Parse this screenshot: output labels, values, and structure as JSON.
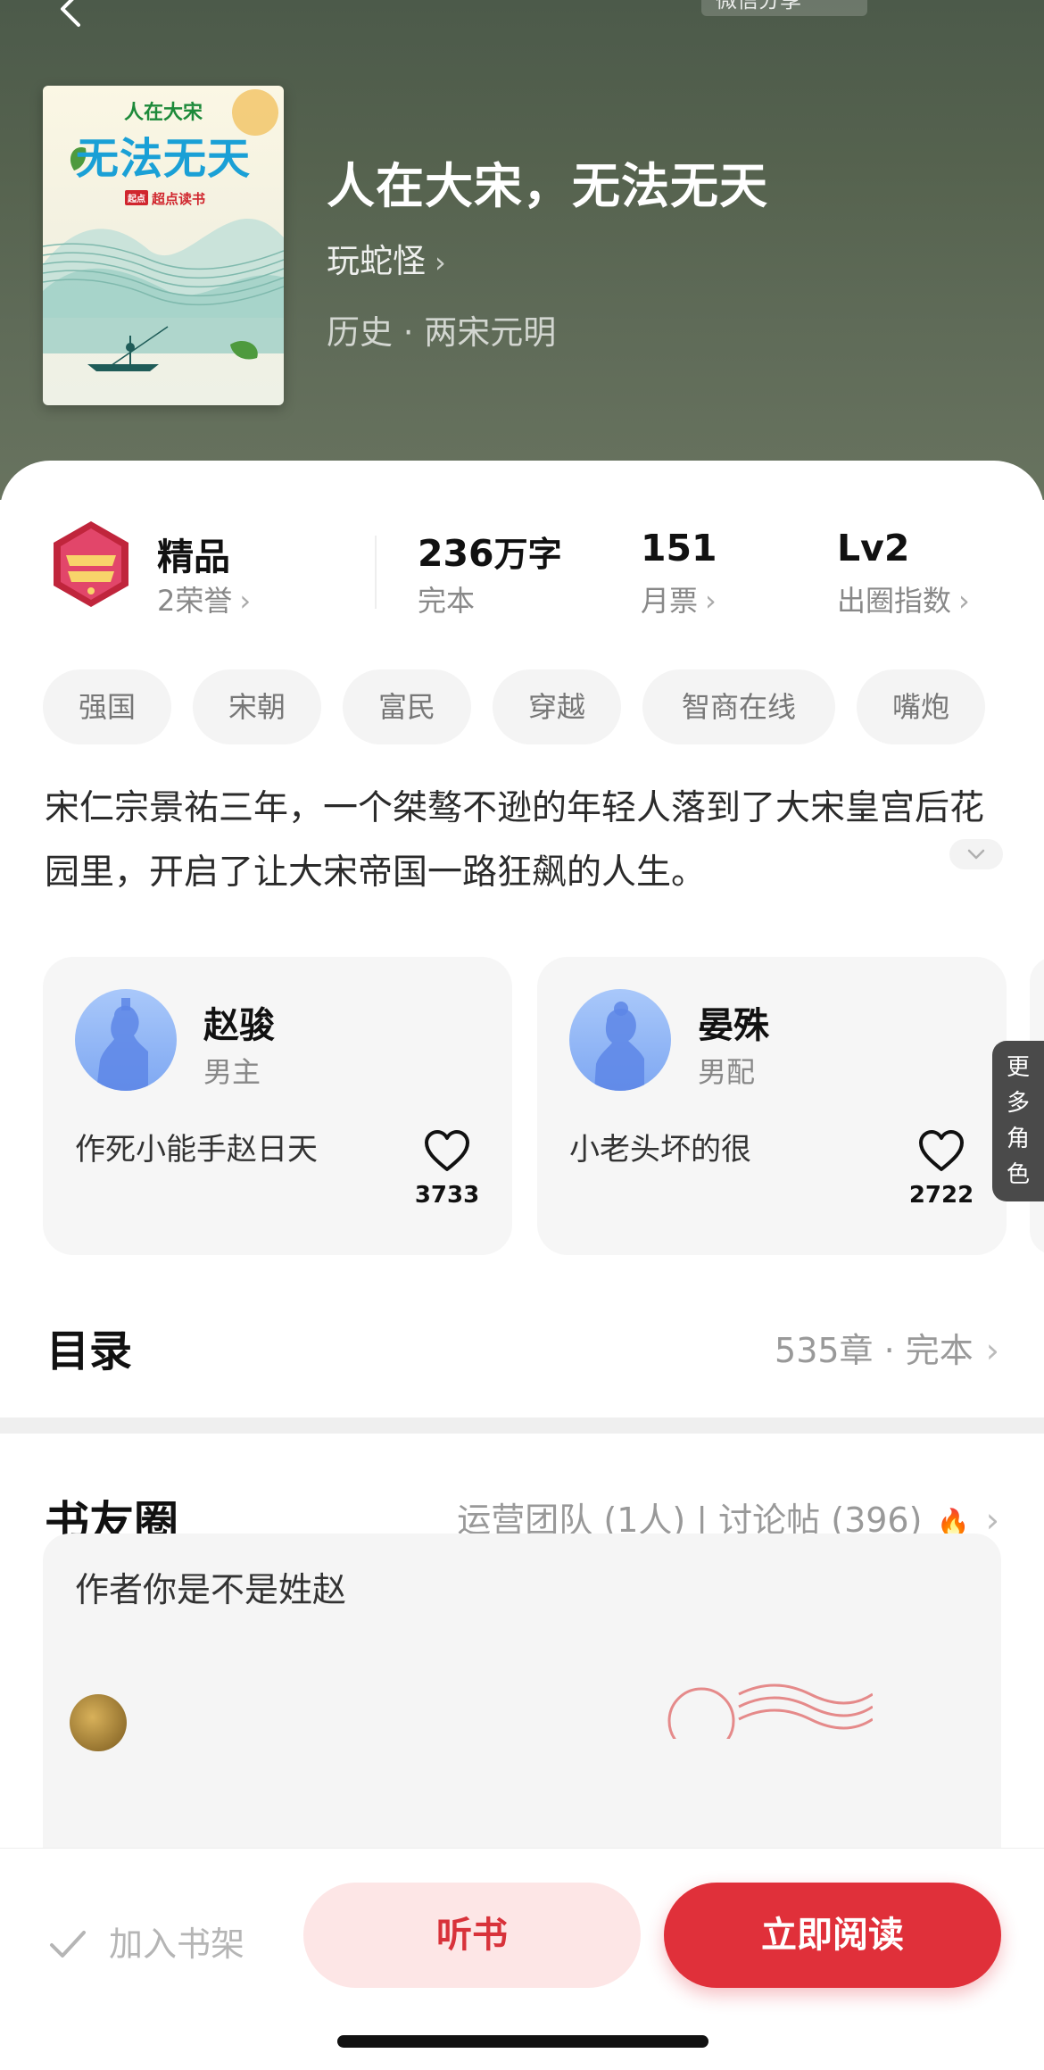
{
  "header": {
    "share_label": "微信分享",
    "book_title": "人在大宋，无法无天",
    "author": "玩蛇怪",
    "category": "历史 · 两宋元明"
  },
  "cover": {
    "subtitle": "人在大宋",
    "title": "无法无天",
    "brand": "超点读书",
    "brand_mark": "起点"
  },
  "stats": {
    "badge": {
      "title": "精品",
      "sub": "2荣誉"
    },
    "words": {
      "value": "236",
      "unit": "万字",
      "sub": "完本"
    },
    "tickets": {
      "value": "151",
      "sub": "月票"
    },
    "level": {
      "value": "Lv2",
      "sub": "出圈指数"
    }
  },
  "tags": [
    "强国",
    "宋朝",
    "富民",
    "穿越",
    "智商在线",
    "嘴炮"
  ],
  "synopsis": "宋仁宗景祐三年，一个桀骜不逊的年轻人落到了大宋皇宫后花园里，开启了让大宋帝国一路狂飙的人生。",
  "roles": [
    {
      "name": "赵骏",
      "type": "男主",
      "quote": "作死小能手赵日天",
      "likes": "3733"
    },
    {
      "name": "晏殊",
      "type": "男配",
      "quote": "小老头坏的很",
      "likes": "2722"
    }
  ],
  "more_roles": "更多角色",
  "toc": {
    "title": "目录",
    "meta": "535章 · 完本"
  },
  "circle": {
    "title": "书友圈",
    "meta": "运营团队 (1人) | 讨论帖 (396)",
    "post_text": "作者你是不是姓赵"
  },
  "actions": {
    "add_shelf": "加入书架",
    "listen": "听书",
    "read": "立即阅读"
  },
  "colors": {
    "accent": "#e0303a",
    "header_bg": "#56634f"
  },
  "icons": [
    "back-arrow-icon",
    "chevron-right-icon",
    "heart-icon",
    "flame-icon",
    "check-icon",
    "chevron-down-icon"
  ]
}
